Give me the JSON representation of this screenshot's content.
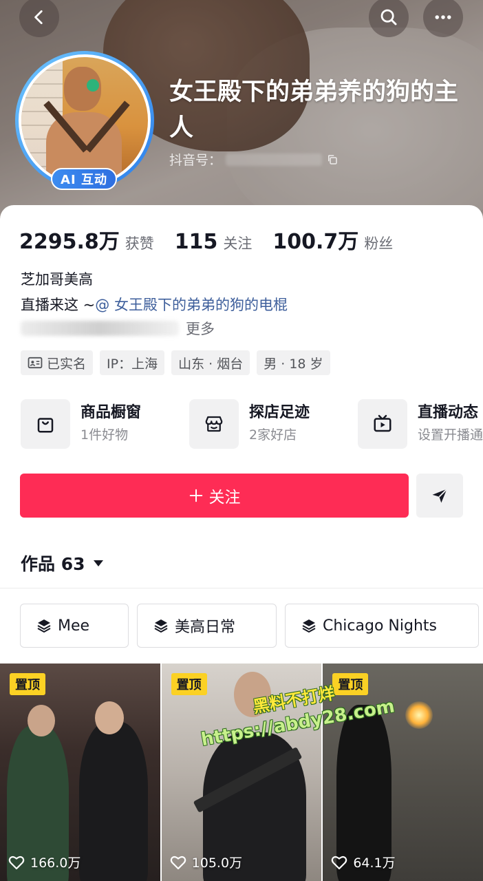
{
  "header": {
    "nickname": "女王殿下的弟弟养的狗的主人",
    "douyin_id_label": "抖音号：",
    "ai_badge": "AI 互动",
    "icons": {
      "back": "back-chevron-icon",
      "search": "search-icon",
      "more": "more-dots-icon",
      "copy": "copy-icon"
    }
  },
  "stats": [
    {
      "value": "2295.8万",
      "label": "获赞"
    },
    {
      "value": "115",
      "label": "关注"
    },
    {
      "value": "100.7万",
      "label": "粉丝"
    }
  ],
  "bio": {
    "line1": "芝加哥美高",
    "line2_prefix": "直播来这 ~",
    "line2_mention": "@ 女王殿下的弟弟的狗的电棍",
    "more": "更多"
  },
  "tags": [
    {
      "icon": "id-card-icon",
      "label": "已实名"
    },
    {
      "label": "IP：上海"
    },
    {
      "label": "山东 · 烟台"
    },
    {
      "label": "男 · 18 岁"
    }
  ],
  "services": [
    {
      "icon": "shopping-bag-icon",
      "title": "商品橱窗",
      "subtitle": "1件好物"
    },
    {
      "icon": "storefront-icon",
      "title": "探店足迹",
      "subtitle": "2家好店"
    },
    {
      "icon": "tv-play-icon",
      "title": "直播动态",
      "subtitle": "设置开播通"
    }
  ],
  "actions": {
    "follow": "关注",
    "follow_icon": "plus-icon",
    "share_icon": "send-icon"
  },
  "works": {
    "label": "作品 63"
  },
  "collections": [
    {
      "icon": "layers-icon",
      "label": "Mee"
    },
    {
      "icon": "layers-icon",
      "label": "美高日常"
    },
    {
      "icon": "layers-icon",
      "label": "Chicago Nights"
    }
  ],
  "videos": [
    {
      "pinned": "置顶",
      "likes": "166.0万"
    },
    {
      "pinned": "置顶",
      "likes": "105.0万"
    },
    {
      "pinned": "置顶",
      "likes": "64.1万"
    }
  ],
  "watermark": {
    "line1": "黑料不打烊",
    "line2": "https://abdy28.com"
  },
  "colors": {
    "accent": "#fe2c55",
    "mention": "#3d5e9b",
    "pin_badge": "#fbd124",
    "ai_badge": "#2f6fe0"
  }
}
